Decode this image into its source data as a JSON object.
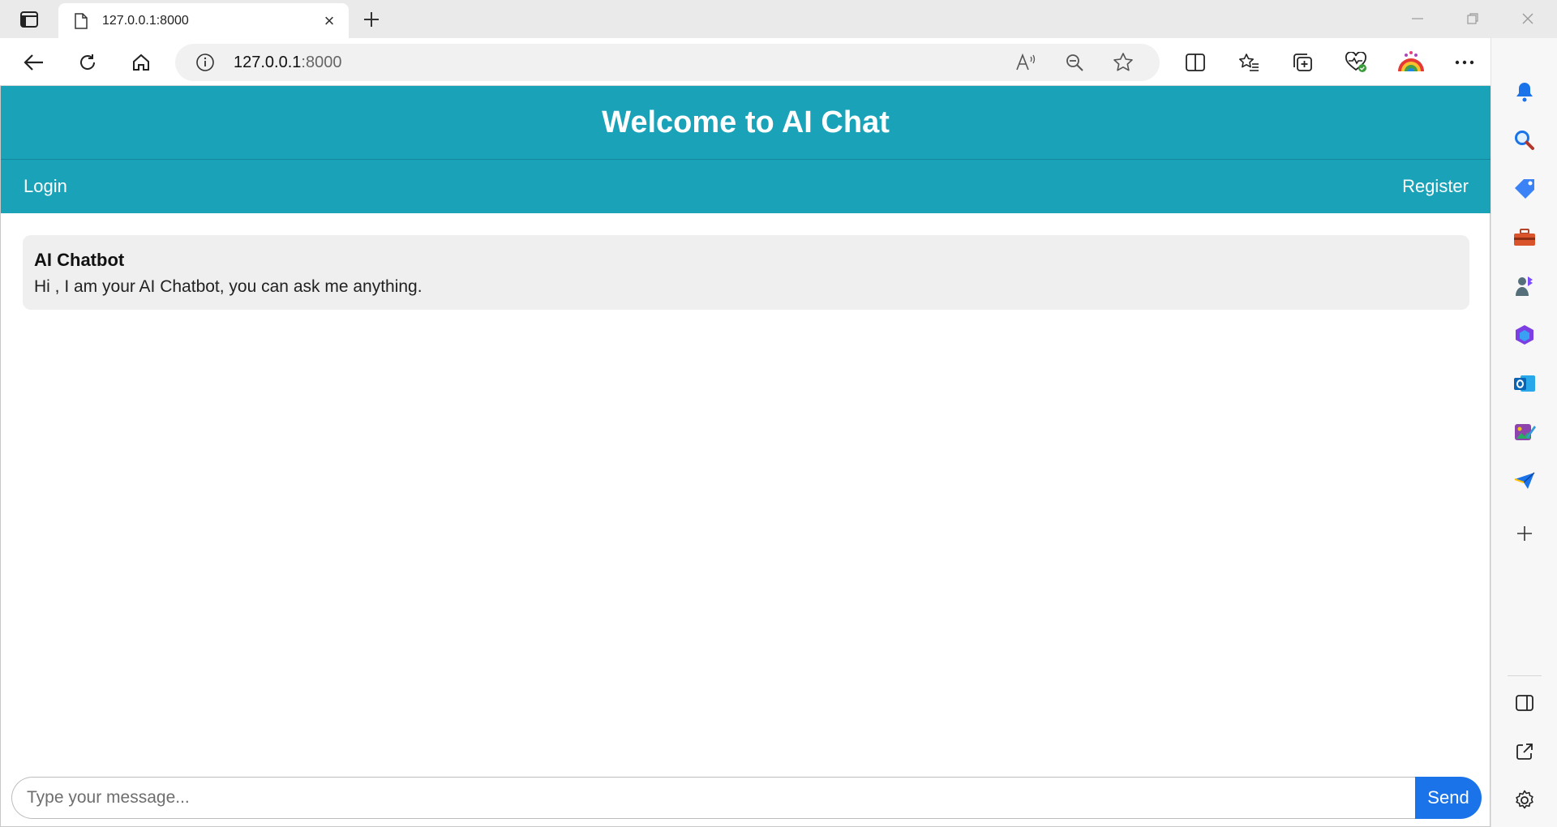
{
  "browser": {
    "tab": {
      "title": "127.0.0.1:8000",
      "close_glyph": "×"
    },
    "new_tab_glyph": "+",
    "address": {
      "host": "127.0.0.1",
      "port": ":8000"
    },
    "icons": {
      "tab_actions": "tab-actions-icon",
      "favicon": "page-icon",
      "back": "back-arrow-icon",
      "refresh": "refresh-icon",
      "home": "home-icon",
      "info": "info-icon",
      "read_aloud": "read-aloud-icon",
      "zoom_out": "zoom-out-icon",
      "favorite": "star-icon",
      "split": "split-screen-icon",
      "favorites": "favorites-icon",
      "collections": "collections-icon",
      "health": "browser-essentials-icon",
      "extension": "extension-icon",
      "more": "more-icon",
      "copilot": "copilot-icon"
    }
  },
  "sidebar": {
    "items": [
      "bell-icon",
      "search-icon",
      "tag-icon",
      "toolbox-icon",
      "games-icon",
      "office-icon",
      "outlook-icon",
      "designer-icon",
      "send-icon",
      "add-icon"
    ],
    "bottom": [
      "sidebar-toggle-icon",
      "external-link-icon",
      "settings-icon"
    ]
  },
  "page": {
    "header_title": "Welcome to AI Chat",
    "nav": {
      "login": "Login",
      "register": "Register"
    },
    "messages": [
      {
        "sender": "AI Chatbot",
        "text": "Hi , I am your AI Chatbot, you can ask me anything."
      }
    ],
    "input": {
      "placeholder": "Type your message...",
      "value": ""
    },
    "send_label": "Send"
  },
  "colors": {
    "header_bg": "#19a2b8",
    "send_bg": "#1a73e8",
    "message_bg": "#efefef"
  }
}
